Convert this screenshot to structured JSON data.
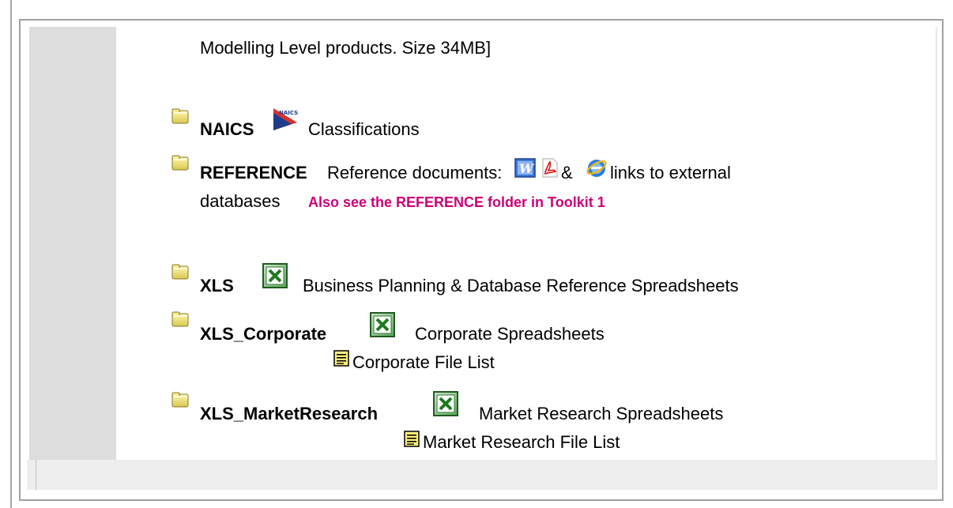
{
  "intro": {
    "text": "Modelling Level products. Size 34MB]"
  },
  "naics": {
    "name": "NAICS",
    "desc": "Classifications",
    "logo_text": "NAICS"
  },
  "reference": {
    "name": "REFERENCE",
    "desc": "Reference documents:",
    "amp": "&",
    "desc2": "links to external",
    "desc3": "databases",
    "link": "Also see the REFERENCE folder in Toolkit 1"
  },
  "xls": {
    "name": "XLS",
    "desc": "Business Planning & Database Reference Spreadsheets"
  },
  "xls_corporate": {
    "name": "XLS_Corporate",
    "desc": "Corporate Spreadsheets",
    "file_list": "Corporate File List"
  },
  "xls_market": {
    "name": "XLS_MarketResearch",
    "desc": "Market Research Spreadsheets",
    "file_list": "Market Research File List"
  },
  "colors": {
    "link": "#cc0077",
    "folder": "#e8dc6a",
    "excel_green": "#2f8a2f",
    "grey_column": "#dddddd"
  },
  "icons": [
    "folder-icon",
    "naics-logo-icon",
    "word-icon",
    "pdf-icon",
    "internet-explorer-icon",
    "excel-icon",
    "document-icon"
  ]
}
